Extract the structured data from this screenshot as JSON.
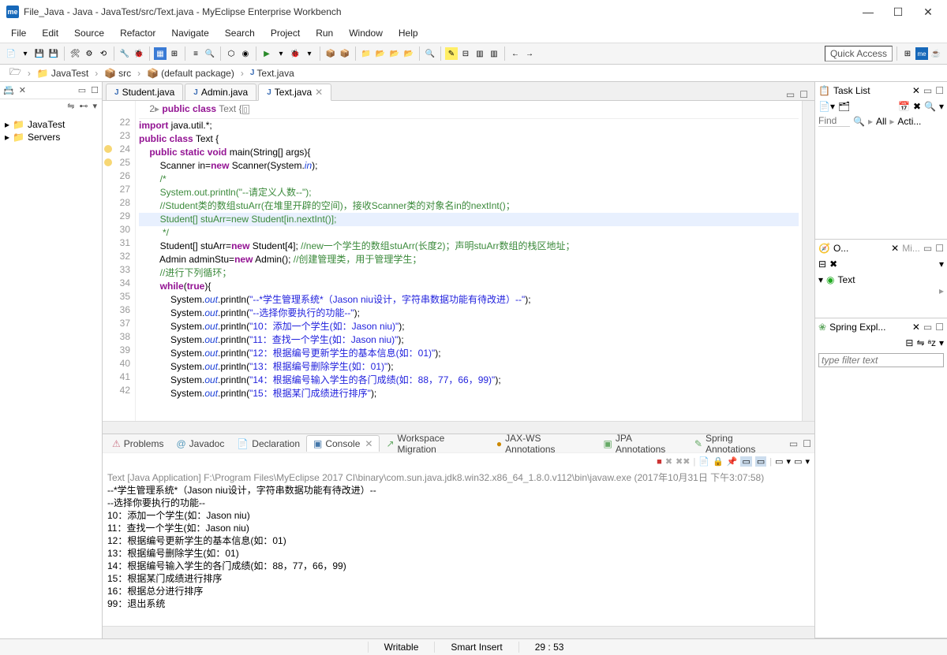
{
  "window": {
    "title": "File_Java - Java - JavaTest/src/Text.java - MyEclipse Enterprise Workbench"
  },
  "menu": [
    "File",
    "Edit",
    "Source",
    "Refactor",
    "Navigate",
    "Search",
    "Project",
    "Run",
    "Window",
    "Help"
  ],
  "quick_access": "Quick Access",
  "breadcrumb": [
    {
      "icon": "🗁",
      "label": ""
    },
    {
      "icon": "📁",
      "label": "JavaTest"
    },
    {
      "icon": "📦",
      "label": "src"
    },
    {
      "icon": "📦",
      "label": "(default package)"
    },
    {
      "icon": "J",
      "label": "Text.java"
    }
  ],
  "package_explorer": {
    "nodes": [
      {
        "exp": "▸",
        "icon": "📁",
        "label": "JavaTest"
      },
      {
        "exp": "▸",
        "icon": "📁",
        "label": "Servers"
      }
    ]
  },
  "editor_tabs": [
    {
      "icon": "J",
      "label": "Student.java",
      "active": false
    },
    {
      "icon": "J",
      "label": "Admin.java",
      "active": false
    },
    {
      "icon": "J",
      "label": "Text.java",
      "active": true,
      "close": true
    }
  ],
  "code": {
    "header_line": "2▸ public class Text {▯",
    "lines": [
      {
        "n": 22,
        "html": "<span class='kw'>import</span> java.util.*;"
      },
      {
        "n": 23,
        "html": "<span class='kw'>public class</span> Text {"
      },
      {
        "n": 24,
        "mark": "#f7d774",
        "html": "    <span class='kw'>public static void</span> main(String[] args){"
      },
      {
        "n": 25,
        "mark": "#f7d774",
        "html": "        Scanner in=<span class='kw'>new</span> Scanner(System.<span class='fi'>in</span>);"
      },
      {
        "n": 26,
        "html": "        <span class='cm'>/*</span>"
      },
      {
        "n": 27,
        "html": "        <span class='cm'>System.out.println(\"--请定义人数--\");</span>"
      },
      {
        "n": 28,
        "html": "        <span class='cm'>//Student类的数组stuArr(在堆里开辟的空间)，接收Scanner类的对象名in的nextInt()；</span>"
      },
      {
        "n": 29,
        "hl": true,
        "html": "        <span class='cm'>Student[] stuArr=new Student[in.nextInt()];</span>"
      },
      {
        "n": 30,
        "html": "        <span class='cm'> */</span>"
      },
      {
        "n": 31,
        "html": "        Student[] stuArr=<span class='kw'>new</span> Student[4]; <span class='cm'>//new一个学生的数组stuArr(长度2)；声明stuArr数组的栈区地址；</span>"
      },
      {
        "n": 32,
        "html": "        Admin adminStu=<span class='kw'>new</span> Admin(); <span class='cm'>//创建管理类，用于管理学生；</span>"
      },
      {
        "n": 33,
        "html": "        <span class='cm'>//进行下列循环；</span>"
      },
      {
        "n": 34,
        "html": "        <span class='kw'>while</span>(<span class='kw'>true</span>){"
      },
      {
        "n": 35,
        "html": "            System.<span class='fi'>out</span>.println(<span class='st'>\"--*学生管理系统*（Jason niu设计，字符串数据功能有待改进）--\"</span>);"
      },
      {
        "n": 36,
        "html": "            System.<span class='fi'>out</span>.println(<span class='st'>\"--选择你要执行的功能--\"</span>);"
      },
      {
        "n": 37,
        "html": "            System.<span class='fi'>out</span>.println(<span class='st'>\"10：添加一个学生(如：Jason niu)\"</span>);"
      },
      {
        "n": 38,
        "html": "            System.<span class='fi'>out</span>.println(<span class='st'>\"11：查找一个学生(如：Jason niu)\"</span>);"
      },
      {
        "n": 39,
        "html": "            System.<span class='fi'>out</span>.println(<span class='st'>\"12：根据编号更新学生的基本信息(如：01)\"</span>);"
      },
      {
        "n": 40,
        "html": "            System.<span class='fi'>out</span>.println(<span class='st'>\"13：根据编号删除学生(如：01)\"</span>);"
      },
      {
        "n": 41,
        "html": "            System.<span class='fi'>out</span>.println(<span class='st'>\"14：根据编号输入学生的各门成绩(如：88，77，66，99)\"</span>);"
      },
      {
        "n": 42,
        "html": "            System.<span class='fi'>out</span>.println(<span class='st'>\"15：根据某门成绩进行排序\"</span>);"
      }
    ]
  },
  "bottom_tabs": [
    {
      "icon": "⚠",
      "label": "Problems",
      "color": "#c78"
    },
    {
      "icon": "@",
      "label": "Javadoc",
      "color": "#59b"
    },
    {
      "icon": "📄",
      "label": "Declaration",
      "color": "#c80"
    },
    {
      "icon": "▣",
      "label": "Console",
      "color": "#47a",
      "active": true,
      "close": true
    },
    {
      "icon": "↗",
      "label": "Workspace Migration",
      "color": "#6a6"
    },
    {
      "icon": "●",
      "label": "JAX-WS Annotations",
      "color": "#c80"
    },
    {
      "icon": "▣",
      "label": "JPA Annotations",
      "color": "#6a6"
    },
    {
      "icon": "✎",
      "label": "Spring Annotations",
      "color": "#6a6"
    }
  ],
  "console": {
    "header": "Text [Java Application] F:\\Program Files\\MyEclipse 2017 CI\\binary\\com.sun.java.jdk8.win32.x86_64_1.8.0.v112\\bin\\javaw.exe (2017年10月31日 下午3:07:58)",
    "lines": [
      "--*学生管理系统*（Jason niu设计，字符串数据功能有待改进）--",
      "--选择你要执行的功能--",
      "10：添加一个学生(如：Jason niu)",
      "11：查找一个学生(如：Jason niu)",
      "12：根据编号更新学生的基本信息(如：01)",
      "13：根据编号删除学生(如：01)",
      "14：根据编号输入学生的各门成绩(如：88，77，66，99)",
      "15：根据某门成绩进行排序",
      "16：根据总分进行排序",
      "99：退出系统"
    ]
  },
  "right": {
    "tasklist": {
      "title": "Task List",
      "find": "Find",
      "all": "All",
      "acti": "Acti..."
    },
    "outline": {
      "tab1": "O...",
      "tab2": "Mi...",
      "item": "Text"
    },
    "spring": {
      "title": "Spring Expl...",
      "filter": "type filter text"
    }
  },
  "status": {
    "writable": "Writable",
    "insert": "Smart Insert",
    "pos": "29 : 53"
  }
}
